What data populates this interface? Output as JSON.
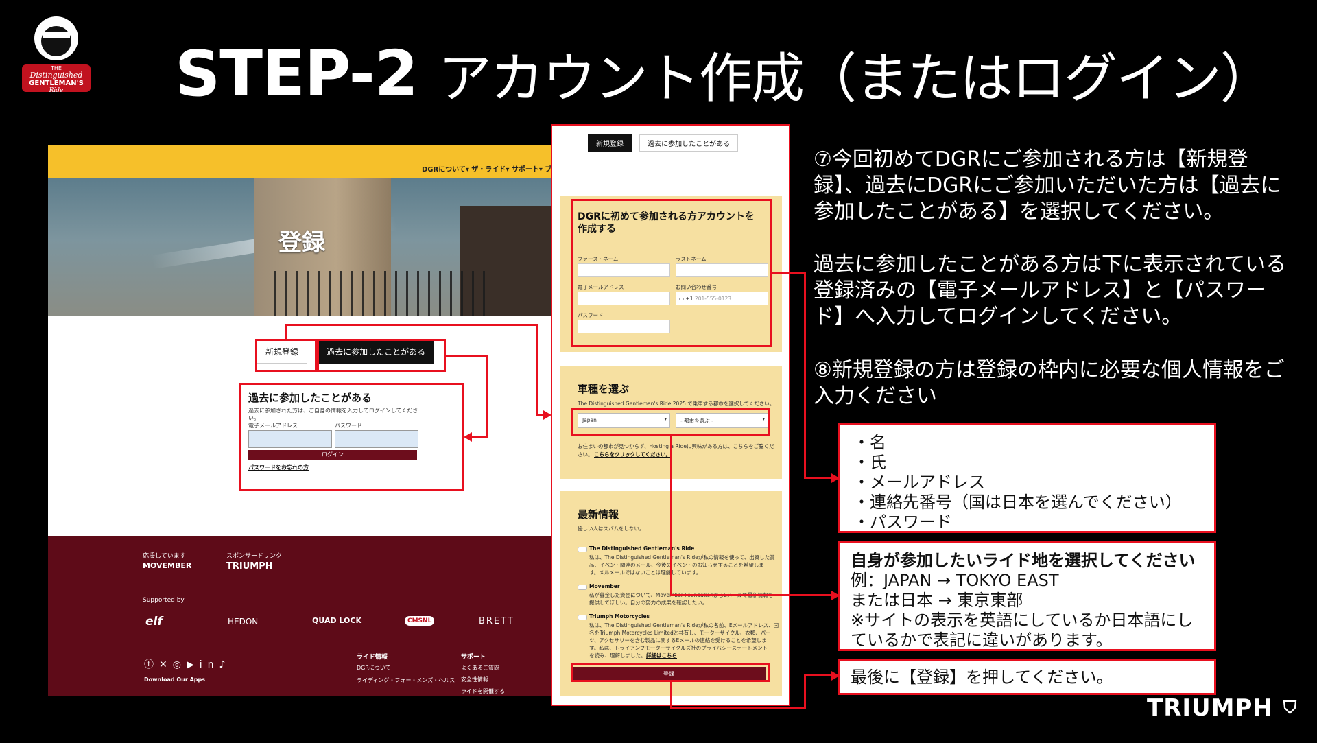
{
  "header": {
    "title_step": "STEP-2",
    "title_jp": "アカウント作成（またはログイン）",
    "logo_text_1": "THE",
    "logo_text_2": "Distinguished",
    "logo_text_3": "GENTLEMAN'S",
    "logo_text_4": "Ride"
  },
  "site": {
    "nav": "DGRについて▾  ザ・ライド▾  サポート▾  ブ",
    "hero_title": "登録",
    "tab_new": "新規登録",
    "tab_past": "過去に参加したことがある",
    "login_heading": "過去に参加したことがある",
    "login_desc": "過去に参加された方は、ご自身の情報を入力してログインしてください。",
    "email_label": "電子メールアドレス",
    "password_label": "パスワード",
    "login_button": "ログイン",
    "forgot_link": "パスワードをお忘れの方",
    "footer": {
      "support_label": "応援しています",
      "sponsor_label": "スポンサードリンク",
      "movember": "MOVEMBER",
      "triumph": "TRIUMPH",
      "supported_by": "Supported by",
      "sponsors": [
        "elf",
        "HEDON",
        "QUAD LOCK",
        "CMSNL",
        "BRETT"
      ],
      "col1_head": "ライド情報",
      "col1_items": [
        "DGRについて",
        "ライディング・フォー・メンズ・ヘルス"
      ],
      "col2_head": "サポート",
      "col2_items": [
        "よくあるご質問",
        "安全性情報",
        "ライドを開催する"
      ],
      "download": "Download Our Apps"
    }
  },
  "form": {
    "tab_new": "新規登録",
    "tab_past": "過去に参加したことがある",
    "account_heading": "DGRに初めて参加される方アカウントを作成する",
    "first_name": "ファーストネーム",
    "last_name": "ラストネーム",
    "email": "電子メールアドレス",
    "phone_label": "お問い合わせ番号",
    "phone_placeholder": "201-555-0123",
    "phone_code": "+1",
    "password": "パスワード",
    "ride_heading": "車種を選ぶ",
    "ride_desc": "The Distinguished Gentleman's Ride 2025 で乗車する都市を選択してください。",
    "country_value": "Japan",
    "city_value": "- 都市を選ぶ -",
    "ride_note_1": "お住まいの都市が見つからず、Hosting a Rideに興味がある方は、こちらをご覧くだ",
    "ride_note_2": "さい。",
    "ride_note_link": "こちらをクリックしてください。",
    "news_heading": "最新情報",
    "news_sub": "優しい人はスパムをしない。",
    "opt1_title": "The Distinguished Gentleman's Ride",
    "opt1_lines": [
      "私は、The Distinguished Gentleman's Rideが私の情報を使って、出資した賞",
      "品、イベント関連のメール、今後のイベントのお知らせすることを希望しま",
      "す。メルメールではないことは理解しています。"
    ],
    "opt2_title": "Movember",
    "opt2_lines": [
      "私が募金した資金について、Movember FoundationからEメールで最新情報を",
      "提供してほしい。自分の努力の成果を確認したい。"
    ],
    "opt3_title": "Triumph Motorcycles",
    "opt3_lines": [
      "私は、The Distinguished Gentleman's Rideが私の名前、Eメールアドレス、国",
      "名をTriumph Motorcycles Limitedと共有し、モーターサイクル、衣類、パー",
      "ツ、アクセサリーを含む製品に関するEメールの連絡を受けることを希望しま",
      "す。私は、トライアンフモーターサイクルズ社のプライバシーステートメント",
      "を読み、理解しました。"
    ],
    "opt3_link": "詳細はこちら",
    "register_button": "登録"
  },
  "instructions": {
    "p1": "⑦今回初めてDGRにご参加される方は【新規登録】、過去にDGRにご参加いただいた方は【過去に参加したことがある】を選択してください。",
    "p2": "過去に参加したことがある方は下に表示されている登録済みの【電子メールアドレス】と【パスワード】へ入力してログインしてください。",
    "p3": "⑧新規登録の方は登録の枠内に必要な個人情報をご入力ください",
    "box1_items": [
      "・名",
      "・氏",
      "・メールアドレス",
      "・連絡先番号（国は日本を選んでください）",
      "・パスワード"
    ],
    "box2_title": "自身が参加したいライド地を選択してください",
    "box2_lines": [
      "例：JAPAN → TOKYO EAST",
      "または日本 → 東京東部",
      "※サイトの表示を英語にしているか日本語にし",
      "ているかで表記に違いがあります。"
    ],
    "box3": "最後に【登録】を押してください。"
  },
  "brand": {
    "triumph": "TRIUMPH"
  },
  "colors": {
    "accent_red": "#e8101f",
    "maroon": "#6d0d1c",
    "yellow": "#f6c02a",
    "form_panel": "#f6e0a1"
  }
}
